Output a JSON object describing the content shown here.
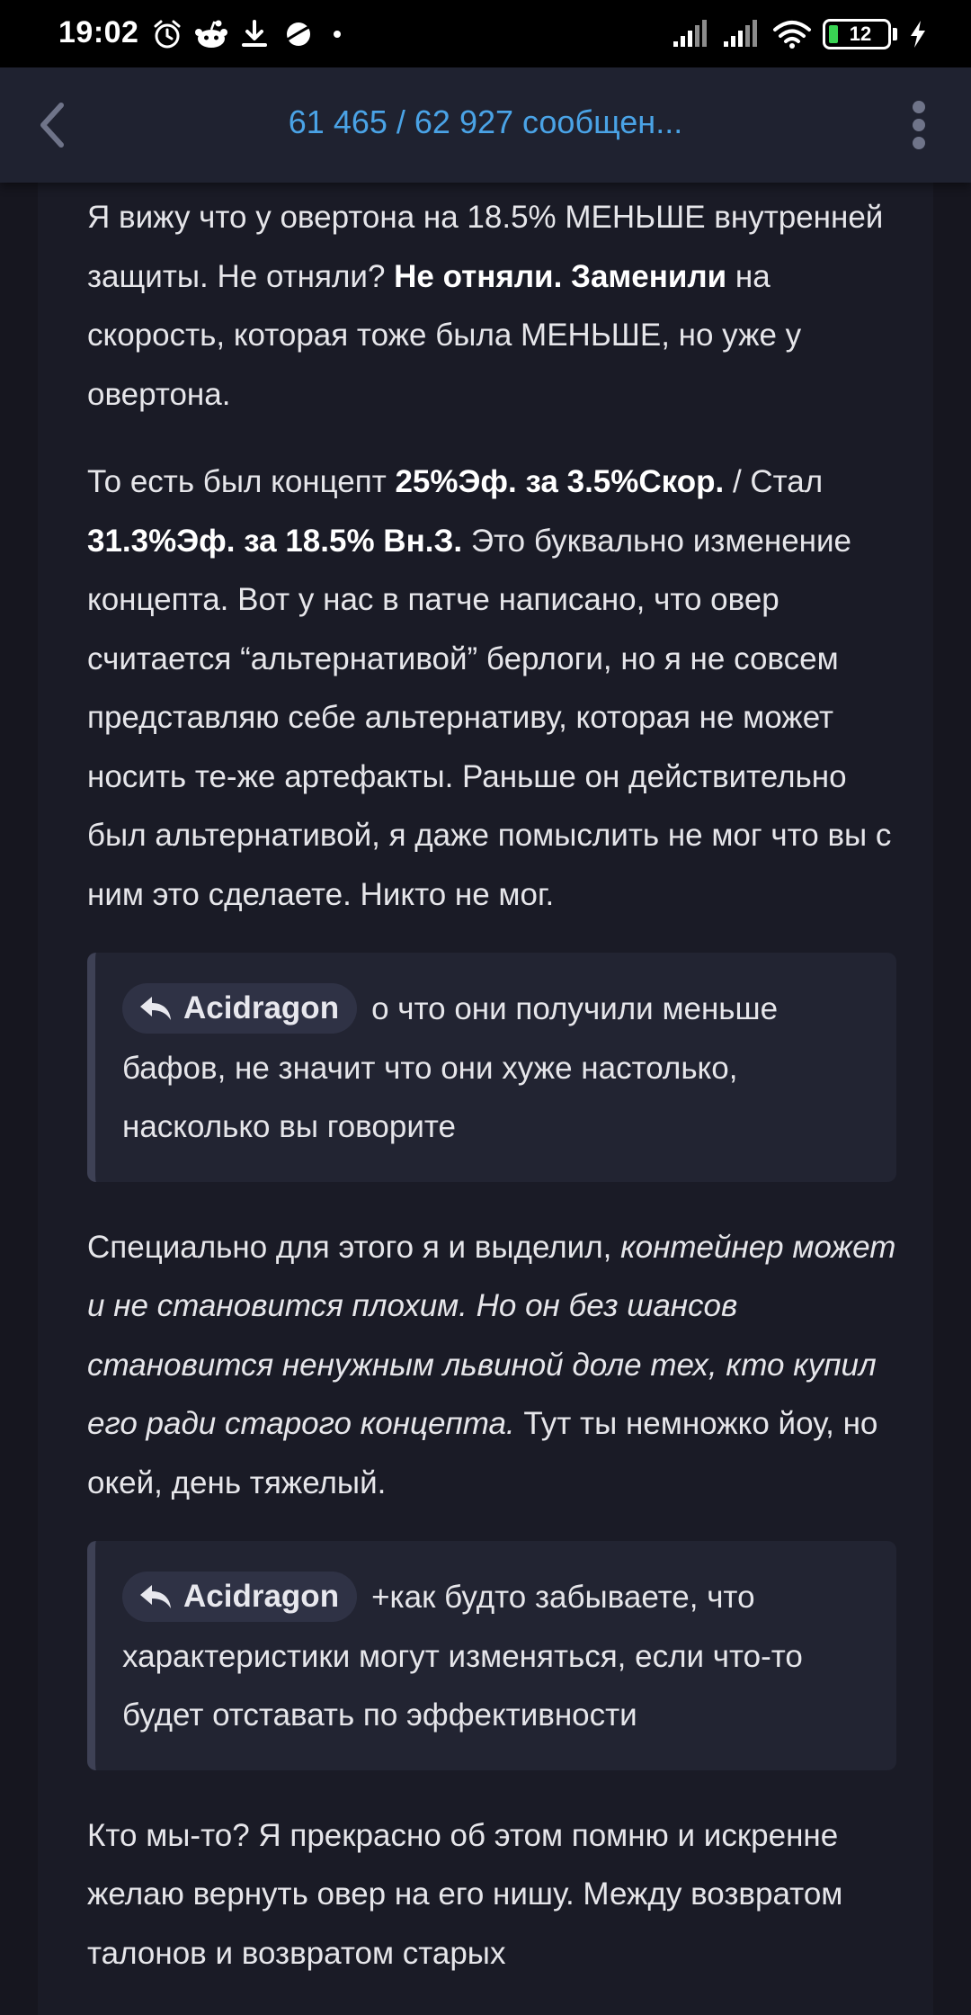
{
  "status_bar": {
    "time": "19:02",
    "battery_level": "12",
    "icons_left": [
      "alarm-icon",
      "reddit-icon",
      "download-icon",
      "planet-icon",
      "dot-icon"
    ],
    "icons_right": [
      "signal-icon",
      "signal-icon",
      "wifi-icon",
      "battery-icon",
      "charging-icon"
    ]
  },
  "header": {
    "title": "61 465 / 62 927 сообщен...",
    "back_icon": "chevron-left-icon",
    "more_icon": "more-vertical-icon",
    "accent_color": "#4aa3e6"
  },
  "post": {
    "para1": {
      "t1": "Я вижу что у овертона на 18.5% МЕНЬШЕ внутренней защиты. Не отняли? ",
      "b1": "Не отняли. Заменили",
      "t2": " на скорость, которая тоже была МЕНЬШЕ, но уже у овертона."
    },
    "para2": {
      "t1": "То есть был концепт ",
      "b1": "25%Эф. за 3.5%Скор.",
      "t2": " / Стал ",
      "b2": "31.3%Эф. за 18.5% Вн.З.",
      "t3": " Это буквально изменение концепта. Вот у нас в патче написано, что овер считается “альтернативой” берлоги, но я не совсем представляю себе альтернативу, которая не может носить те-же артефакты. Раньше он действительно был альтернативой, я даже помыслить не мог что вы с ним это сделаете. Никто не мог."
    },
    "quote1": {
      "author": "Acidragon",
      "text": "о что они получили меньше бафов, не значит что они хуже настолько, насколько вы говорите"
    },
    "para3": {
      "t1": "Специально для этого я и выделил, ",
      "i1": "контейнер может и не становится плохим. Но он без шансов становится ненужным львиной доле тех, кто купил его ради старого концепта.",
      "t2": " Тут ты немножко йоу, но окей, день тяжелый."
    },
    "quote2": {
      "author": "Acidragon",
      "text": "+как будто забываете, что характеристики могут изменяться, если что-то будет отставать по эффективности"
    },
    "para4": {
      "t1": "Кто мы-то? Я прекрасно об этом помню и искренне желаю вернуть овер на его нишу. Между возвратом талонов и возвратом старых"
    }
  }
}
